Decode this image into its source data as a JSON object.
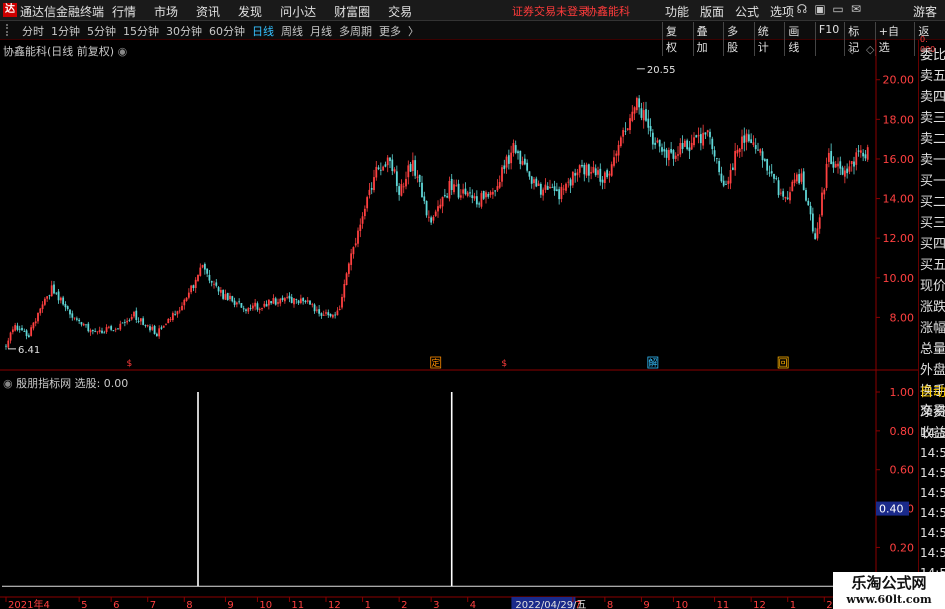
{
  "menubar": {
    "logo": "达",
    "app_title": "通达信金融终端",
    "menus": [
      "行情",
      "市场",
      "资讯",
      "发现",
      "问小达",
      "财富圈",
      "交易"
    ],
    "warning": "证券交易未登录",
    "stock_name": "协鑫能科",
    "right_menus": [
      "功能",
      "版面",
      "公式",
      "选项"
    ],
    "icons": [
      "☊",
      "▣",
      "▭",
      "✉"
    ],
    "guest": "游客"
  },
  "toolbar": {
    "periods": [
      "分时",
      "1分钟",
      "5分钟",
      "15分钟",
      "30分钟",
      "60分钟",
      "日线",
      "周线",
      "月线",
      "多周期",
      "更多"
    ],
    "active": "日线",
    "more_glyph": "〉",
    "tools": [
      "复权",
      "叠加",
      "多股",
      "统计",
      "画线",
      "F10",
      "标记",
      "+自选",
      "返回"
    ]
  },
  "main_panel": {
    "title": "协鑫能科(日线 前复权)",
    "title_icon": "◉",
    "corner_icons": [
      "◇",
      "◇"
    ],
    "max_label": "20.55",
    "min_label": "6.41",
    "y_ticks": [
      "20.00",
      "18.00",
      "16.00",
      "14.00",
      "12.00",
      "10.00",
      "8.00"
    ],
    "y_tick_values": [
      20,
      18,
      16,
      14,
      12,
      10,
      8
    ],
    "y_range": [
      6.0,
      21.4
    ],
    "markers": [
      {
        "label": "$",
        "color": "#ff3b3b",
        "boxed": false,
        "day": 54
      },
      {
        "label": "定",
        "color": "#ff8c00",
        "boxed": true,
        "day": 188
      },
      {
        "label": "$",
        "color": "#ff3b3b",
        "boxed": false,
        "day": 218
      },
      {
        "label": "解",
        "color": "#35c0ff",
        "boxed": true,
        "day": 283
      },
      {
        "label": "回",
        "color": "#ffb000",
        "boxed": true,
        "day": 340
      }
    ]
  },
  "indicator_panel": {
    "title_name": "殷朋指标网",
    "title_value": "选股: 0.00",
    "title_icon": "◉",
    "y_ticks": [
      "1.00",
      "0.80",
      "0.60",
      "0.40",
      "0.20"
    ],
    "y_tick_values": [
      1.0,
      0.8,
      0.6,
      0.4,
      0.2
    ],
    "y_range": [
      -0.05,
      1.0
    ],
    "cursor_value": "0.40",
    "cursor_y": 0.4,
    "spikes": [
      {
        "day": 84,
        "value": 1.0
      },
      {
        "day": 195,
        "value": 1.0
      }
    ]
  },
  "date_axis": {
    "labels": [
      "2021年4",
      "5",
      "6",
      "7",
      "8",
      "9",
      "10",
      "11",
      "12",
      "1",
      "2",
      "3",
      "4",
      "2022/04/29/五",
      "7",
      "8",
      "9",
      "10",
      "11",
      "12",
      "1",
      "2"
    ],
    "label_days": [
      0,
      32,
      46,
      62,
      78,
      96,
      110,
      124,
      140,
      156,
      172,
      186,
      202,
      222,
      248,
      262,
      278,
      292,
      310,
      326,
      342,
      358
    ],
    "highlight": "2022/04/29/五",
    "highlight_color": "#1a2a8a"
  },
  "quote_panel": {
    "header": [
      "0.",
      "000"
    ],
    "items": [
      "委比",
      "卖五",
      "卖四",
      "卖三",
      "卖二",
      "卖一",
      "买一",
      "买二",
      "买三",
      "买四",
      "买五",
      "现价",
      "涨跌",
      "涨幅",
      "总量",
      "外盘",
      "换手",
      "净资",
      "收益"
    ],
    "trade_header": [
      "自动",
      "交易"
    ],
    "ticks": [
      "14:56",
      "14:56",
      "14:56",
      "14:56",
      "14:56",
      "14:56",
      "14:56",
      "14:56",
      "14:56"
    ]
  },
  "watermark": {
    "title": "乐淘公式网",
    "url": "www.60lt.com"
  },
  "colors": {
    "up": "#ff4040",
    "down": "#5fd7d7",
    "axis": "#8b0000",
    "grid": "#3a0000",
    "text": "#c8c8c8",
    "active_period": "#35c0ff",
    "auto_trade": "#ffd000"
  },
  "chart_data": {
    "type": "candlestick",
    "title": "协鑫能科(日线 前复权)",
    "num_days": 378,
    "y_range": [
      6.0,
      21.4
    ],
    "anchors": [
      [
        0,
        6.6
      ],
      [
        4,
        7.6
      ],
      [
        10,
        7.1
      ],
      [
        20,
        9.5
      ],
      [
        28,
        8.1
      ],
      [
        38,
        7.3
      ],
      [
        48,
        7.4
      ],
      [
        56,
        8.1
      ],
      [
        66,
        7.2
      ],
      [
        76,
        8.4
      ],
      [
        86,
        10.5
      ],
      [
        94,
        9.2
      ],
      [
        104,
        8.5
      ],
      [
        112,
        8.6
      ],
      [
        122,
        9.0
      ],
      [
        132,
        8.7
      ],
      [
        140,
        8.1
      ],
      [
        146,
        8.4
      ],
      [
        150,
        10.8
      ],
      [
        156,
        12.9
      ],
      [
        162,
        15.5
      ],
      [
        168,
        15.9
      ],
      [
        172,
        14.4
      ],
      [
        178,
        15.9
      ],
      [
        186,
        12.6
      ],
      [
        194,
        14.6
      ],
      [
        204,
        13.9
      ],
      [
        212,
        14.1
      ],
      [
        222,
        16.5
      ],
      [
        228,
        15.2
      ],
      [
        234,
        14.5
      ],
      [
        242,
        14.2
      ],
      [
        252,
        15.6
      ],
      [
        262,
        15.0
      ],
      [
        270,
        17.4
      ],
      [
        276,
        19.0
      ],
      [
        282,
        17.2
      ],
      [
        290,
        16.2
      ],
      [
        296,
        16.5
      ],
      [
        302,
        17.0
      ],
      [
        308,
        17.3
      ],
      [
        314,
        14.4
      ],
      [
        322,
        17.2
      ],
      [
        328,
        16.8
      ],
      [
        334,
        15.5
      ],
      [
        340,
        14.0
      ],
      [
        348,
        15.2
      ],
      [
        354,
        11.8
      ],
      [
        360,
        16.2
      ],
      [
        366,
        15.1
      ],
      [
        372,
        16.0
      ],
      [
        378,
        16.5
      ]
    ]
  }
}
